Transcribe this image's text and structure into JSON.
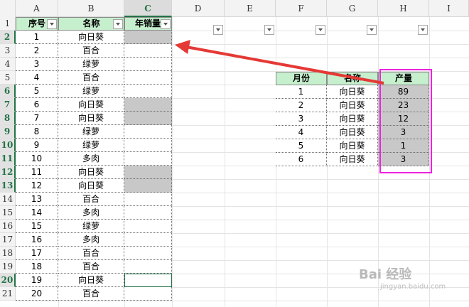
{
  "column_headers": [
    "A",
    "B",
    "C",
    "D",
    "E",
    "F",
    "G",
    "H",
    "I"
  ],
  "row_headers": [
    "1",
    "2",
    "3",
    "4",
    "5",
    "6",
    "7",
    "8",
    "9",
    "10",
    "11",
    "12",
    "13",
    "14",
    "15",
    "16",
    "17",
    "18",
    "19",
    "20",
    "21"
  ],
  "active_column": "C",
  "main_table": {
    "headers": [
      "序号",
      "名称",
      "年销量"
    ],
    "rows": [
      {
        "no": "1",
        "name": "向日葵"
      },
      {
        "no": "2",
        "name": "百合"
      },
      {
        "no": "3",
        "name": "绿萝"
      },
      {
        "no": "4",
        "name": "百合"
      },
      {
        "no": "5",
        "name": "绿萝"
      },
      {
        "no": "6",
        "name": "向日葵"
      },
      {
        "no": "7",
        "name": "向日葵"
      },
      {
        "no": "8",
        "name": "绿萝"
      },
      {
        "no": "9",
        "name": "绿萝"
      },
      {
        "no": "10",
        "name": "多肉"
      },
      {
        "no": "11",
        "name": "向日葵"
      },
      {
        "no": "12",
        "name": "向日葵"
      },
      {
        "no": "13",
        "name": "百合"
      },
      {
        "no": "14",
        "name": "多肉"
      },
      {
        "no": "15",
        "name": "绿萝"
      },
      {
        "no": "16",
        "name": "多肉"
      },
      {
        "no": "17",
        "name": "百合"
      },
      {
        "no": "18",
        "name": "百合"
      },
      {
        "no": "19",
        "name": "向日葵"
      },
      {
        "no": "20",
        "name": "百合"
      }
    ]
  },
  "side_table": {
    "headers": [
      "月份",
      "名称",
      "产量"
    ],
    "rows": [
      {
        "month": "1",
        "name": "向日葵",
        "output": "89"
      },
      {
        "month": "2",
        "name": "向日葵",
        "output": "23"
      },
      {
        "month": "3",
        "name": "向日葵",
        "output": "12"
      },
      {
        "month": "4",
        "name": "向日葵",
        "output": "3"
      },
      {
        "month": "5",
        "name": "向日葵",
        "output": "1"
      },
      {
        "month": "6",
        "name": "向日葵",
        "output": "3"
      }
    ]
  },
  "watermark": {
    "text": "Bai 经验",
    "sub": "jingyan.baidu.com"
  },
  "colors": {
    "header_green": "#c6efce",
    "highlight_gray": "#c8c8c8",
    "arrow_red": "#e53935",
    "box_magenta": "#ee22dd",
    "excel_green": "#217346"
  }
}
